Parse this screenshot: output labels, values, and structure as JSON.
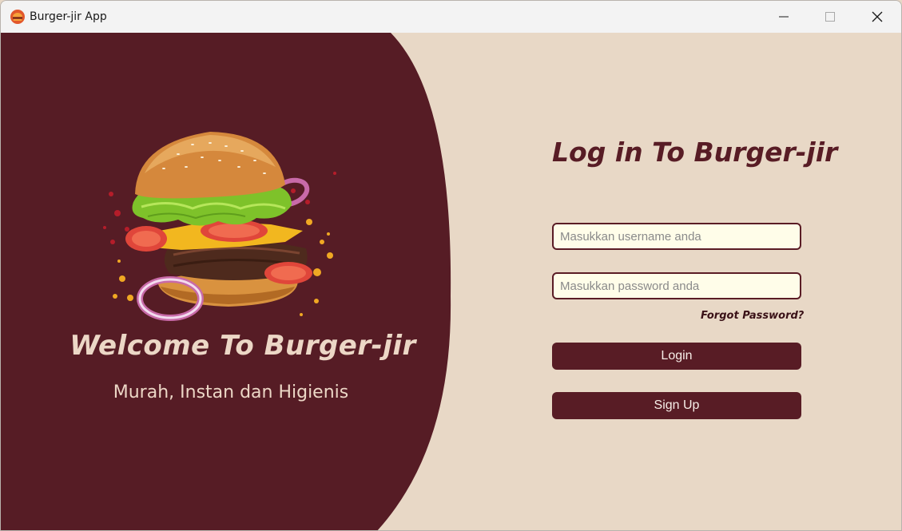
{
  "window": {
    "title": "Burger-jir App",
    "icon": "burger-logo-icon",
    "controls": [
      "minimize-icon",
      "maximize-icon",
      "close-icon"
    ]
  },
  "hero": {
    "image": "burger-illustration",
    "title": "Welcome To Burger-jir",
    "subtitle": "Murah, Instan dan Higienis"
  },
  "login": {
    "title": "Log in To Burger-jir",
    "username_placeholder": "Masukkan username anda",
    "username_value": "",
    "password_placeholder": "Masukkan password anda",
    "password_value": "",
    "forgot_label": "Forgot Password?",
    "login_label": "Login",
    "signup_label": "Sign Up"
  },
  "colors": {
    "accent": "#581c25",
    "background": "#e8d8c6",
    "field_bg": "#fffde9",
    "text_light": "#ecd7c6"
  }
}
